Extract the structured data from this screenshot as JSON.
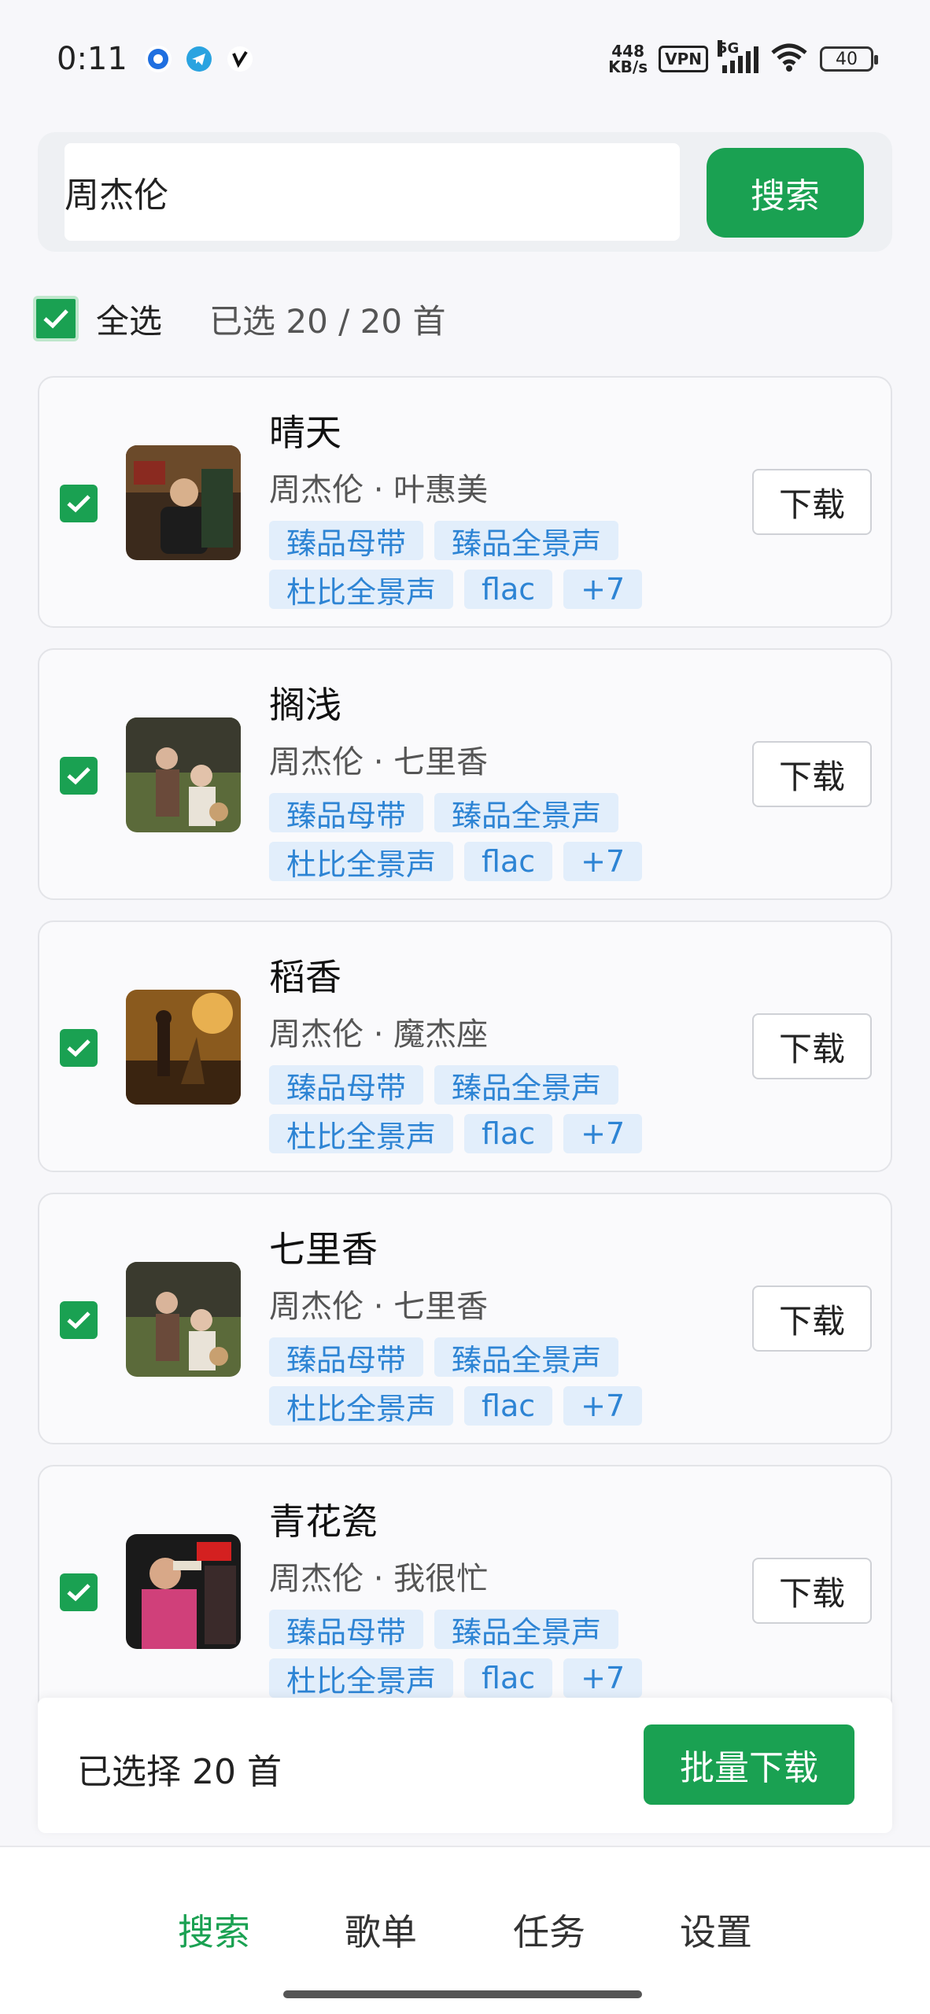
{
  "status": {
    "time": "0:11",
    "net_speed_value": "448",
    "net_speed_unit": "KB/s",
    "vpn": "VPN",
    "network": "5G",
    "battery": "40"
  },
  "search": {
    "value": "周杰伦",
    "button_label": "搜索"
  },
  "selection": {
    "select_all_label": "全选",
    "count_text": "已选 20 / 20 首"
  },
  "songs": [
    {
      "title": "晴天",
      "subtitle": "周杰伦 · 叶惠美",
      "tags": [
        "臻品母带",
        "臻品全景声",
        "杜比全景声",
        "flac",
        "+7"
      ],
      "button": "下载",
      "cover": "album-cover-1"
    },
    {
      "title": "搁浅",
      "subtitle": "周杰伦 · 七里香",
      "tags": [
        "臻品母带",
        "臻品全景声",
        "杜比全景声",
        "flac",
        "+7"
      ],
      "button": "下载",
      "cover": "album-cover-2"
    },
    {
      "title": "稻香",
      "subtitle": "周杰伦 · 魔杰座",
      "tags": [
        "臻品母带",
        "臻品全景声",
        "杜比全景声",
        "flac",
        "+7"
      ],
      "button": "下载",
      "cover": "album-cover-3"
    },
    {
      "title": "七里香",
      "subtitle": "周杰伦 · 七里香",
      "tags": [
        "臻品母带",
        "臻品全景声",
        "杜比全景声",
        "flac",
        "+7"
      ],
      "button": "下载",
      "cover": "album-cover-2"
    },
    {
      "title": "青花瓷",
      "subtitle": "周杰伦 · 我很忙",
      "tags": [
        "臻品母带",
        "臻品全景声",
        "杜比全景声",
        "flac",
        "+7"
      ],
      "button": "下载",
      "cover": "album-cover-4"
    }
  ],
  "batch": {
    "label": "已选择 20 首",
    "button": "批量下载"
  },
  "tabs": [
    {
      "label": "搜索",
      "active": true
    },
    {
      "label": "歌单",
      "active": false
    },
    {
      "label": "任务",
      "active": false
    },
    {
      "label": "设置",
      "active": false
    }
  ],
  "colors": {
    "accent": "#1aa152",
    "tag_bg": "#e2eefb",
    "tag_text": "#2d84d4"
  }
}
